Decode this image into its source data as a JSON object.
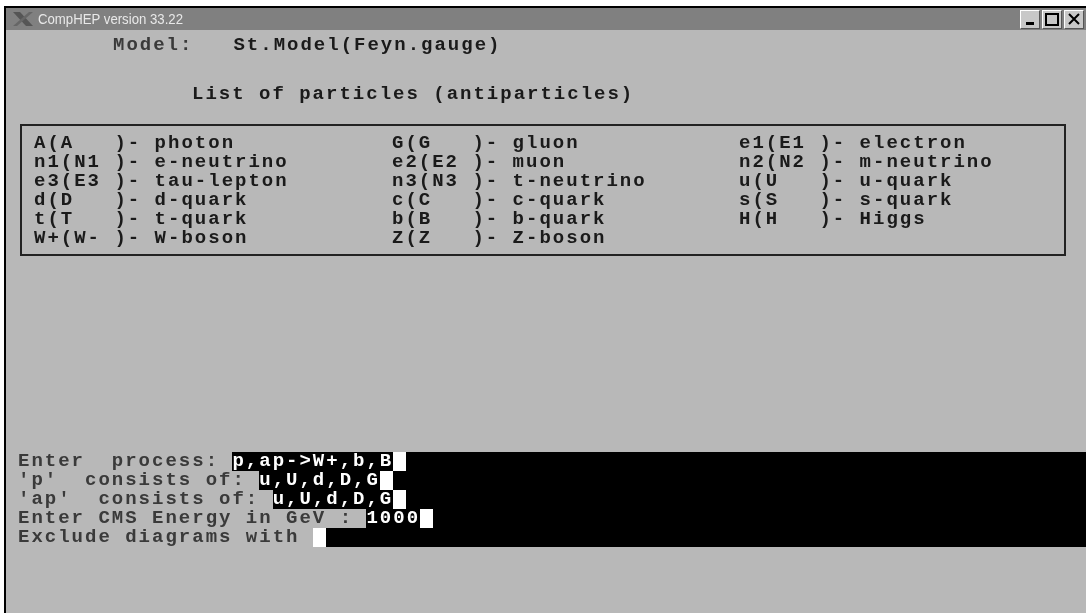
{
  "window": {
    "title": "CompHEP version 33.22"
  },
  "model": {
    "label": "Model:",
    "value": "St.Model(Feyn.gauge)"
  },
  "particles": {
    "heading": "List of particles (antiparticles)",
    "items": [
      "A(A   )- photon",
      "G(G   )- gluon",
      "e1(E1 )- electron",
      "n1(N1 )- e-neutrino",
      "e2(E2 )- muon",
      "n2(N2 )- m-neutrino",
      "e3(E3 )- tau-lepton",
      "n3(N3 )- t-neutrino",
      "u(U   )- u-quark",
      "d(D   )- d-quark",
      "c(C   )- c-quark",
      "s(S   )- s-quark",
      "t(T   )- t-quark",
      "b(B   )- b-quark",
      "H(H   )- Higgs",
      "W+(W- )- W-boson",
      "Z(Z   )- Z-boson"
    ]
  },
  "prompts": [
    {
      "label": "Enter  process: ",
      "value": "p,ap->W+,b,B"
    },
    {
      "label": "'p'  consists of: ",
      "value": "u,U,d,D,G"
    },
    {
      "label": "'ap'  consists of: ",
      "value": "u,U,d,D,G"
    },
    {
      "label": "Enter CMS Energy in GeV : ",
      "value": "1000"
    },
    {
      "label": "Exclude diagrams with "
    }
  ]
}
